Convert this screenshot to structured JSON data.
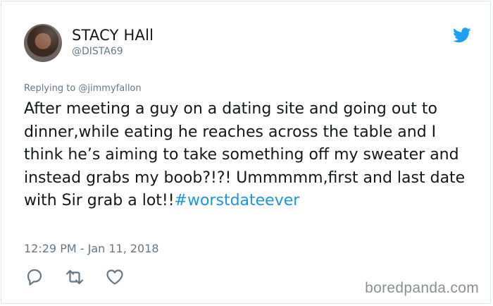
{
  "user": {
    "display_name": "STACY HAll",
    "handle": "@DISTA69",
    "avatar_icon": "avatar"
  },
  "tweet": {
    "replying_to": "Replying to @jimmyfallon",
    "text": "After meeting a guy on a dating site and going out to dinner,while eating he reaches across the table and I think he’s aiming to take something off my sweater and instead grabs my boob?!?! Ummmmm,first and last date with Sir grab a lot!!",
    "hashtag": "#worstdateever",
    "timestamp": "12:29 PM - Jan 11, 2018"
  },
  "actions": {
    "reply_icon": "reply-icon",
    "retweet_icon": "retweet-icon",
    "like_icon": "heart-icon"
  },
  "brand": {
    "logo_icon": "twitter-bird-icon",
    "watermark": "boredpanda.com"
  },
  "colors": {
    "twitter_blue": "#1da1f2",
    "link_blue": "#1b95e0",
    "muted_gray": "#657786",
    "text": "#14171a"
  }
}
